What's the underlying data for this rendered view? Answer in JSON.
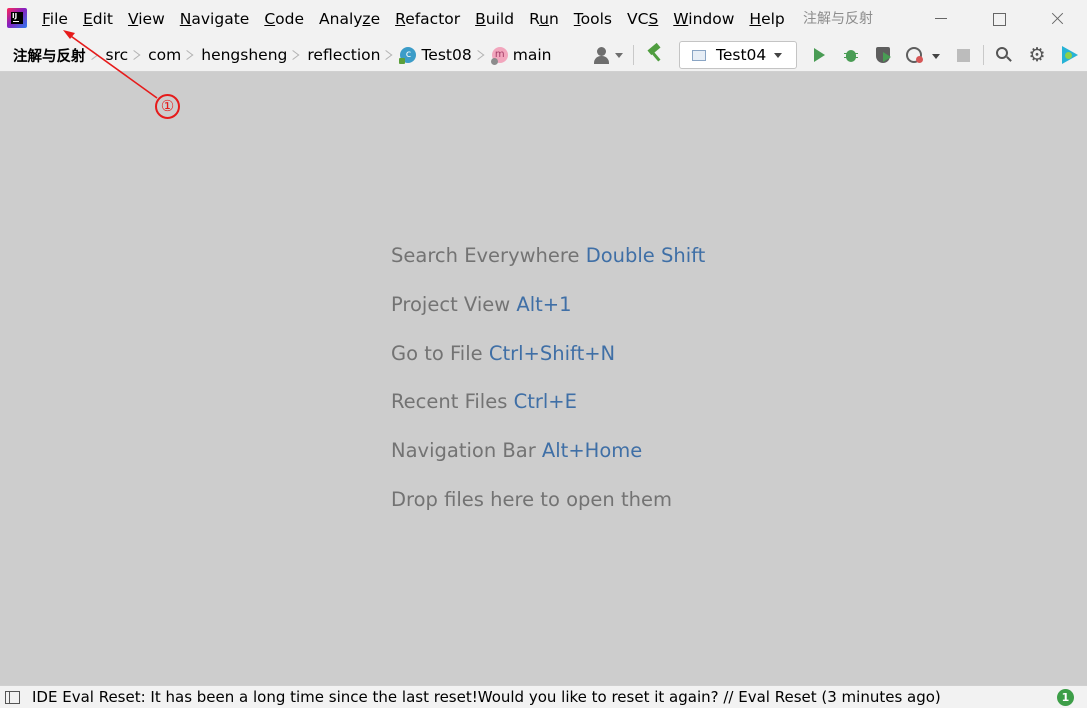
{
  "window": {
    "project_title": "注解与反射"
  },
  "menu": {
    "items": [
      {
        "pre": "",
        "u": "F",
        "post": "ile"
      },
      {
        "pre": "",
        "u": "E",
        "post": "dit"
      },
      {
        "pre": "",
        "u": "V",
        "post": "iew"
      },
      {
        "pre": "",
        "u": "N",
        "post": "avigate"
      },
      {
        "pre": "",
        "u": "C",
        "post": "ode"
      },
      {
        "pre": "Analy",
        "u": "z",
        "post": "e"
      },
      {
        "pre": "",
        "u": "R",
        "post": "efactor"
      },
      {
        "pre": "",
        "u": "B",
        "post": "uild"
      },
      {
        "pre": "R",
        "u": "u",
        "post": "n"
      },
      {
        "pre": "",
        "u": "T",
        "post": "ools"
      },
      {
        "pre": "VC",
        "u": "S",
        "post": ""
      },
      {
        "pre": "",
        "u": "W",
        "post": "indow"
      },
      {
        "pre": "",
        "u": "H",
        "post": "elp"
      }
    ]
  },
  "breadcrumb": {
    "project": "注解与反射",
    "src": "src",
    "pkg1": "com",
    "pkg2": "hengsheng",
    "pkg3": "reflection",
    "class_name": "Test08",
    "class_icon_letter": "c",
    "method_name": "main",
    "method_icon_letter": "m"
  },
  "toolbar": {
    "run_config": "Test04",
    "gear_glyph": "⚙"
  },
  "hints": [
    {
      "label": "Search Everywhere",
      "key": "Double Shift"
    },
    {
      "label": "Project View",
      "key": "Alt+1"
    },
    {
      "label": "Go to File",
      "key": "Ctrl+Shift+N"
    },
    {
      "label": "Recent Files",
      "key": "Ctrl+E"
    },
    {
      "label": "Navigation Bar",
      "key": "Alt+Home"
    },
    {
      "label": "Drop files here to open them",
      "key": ""
    }
  ],
  "annotation": {
    "marker": "①",
    "color": "#e61b1b"
  },
  "status": {
    "message": "IDE Eval Reset: It has been a long time since the last reset!Would you like to reset it again? // Eval Reset (3 minutes ago)",
    "event_count": "1"
  },
  "colors": {
    "run_green": "#499c54",
    "hint_key_blue": "#3f6fa6",
    "editor_bg": "#cdcdcd"
  }
}
